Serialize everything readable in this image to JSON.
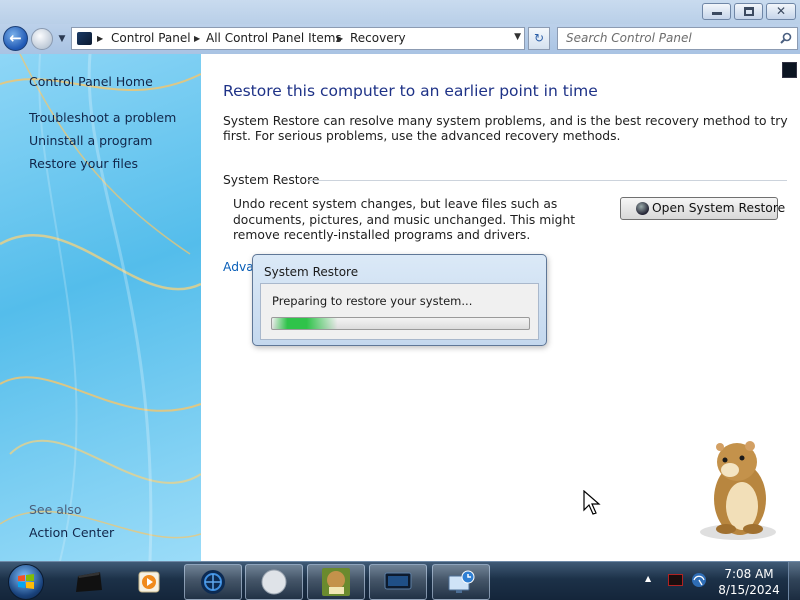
{
  "window": {
    "address_breadcrumbs": [
      "Control Panel",
      "All Control Panel Items",
      "Recovery"
    ],
    "search_placeholder": "Search Control Panel"
  },
  "sidebar": {
    "home": "Control Panel Home",
    "tasks": [
      "Troubleshoot a problem",
      "Uninstall a program",
      "Restore your files"
    ],
    "see_also_label": "See also",
    "see_also_links": [
      "Action Center"
    ]
  },
  "main": {
    "title": "Restore this computer to an earlier point in time",
    "intro": "System Restore can resolve many system problems, and is the best recovery method to try first. For serious problems, use the advanced recovery methods.",
    "section_title": "System Restore",
    "section_description": "Undo recent system changes, but leave files such as documents, pictures, and music unchanged. This might remove recently-installed programs and drivers.",
    "open_button": "Open System Restore",
    "advanced_link": "Adva"
  },
  "dialog": {
    "title": "System Restore",
    "message": "Preparing to restore your system...",
    "progress_fraction": 0.3
  },
  "taskbar": {
    "items": [
      "terminal-app-icon",
      "media-player-icon",
      "globe-app-icon",
      "blank-app-icon",
      "box-game-icon",
      "display-app-icon",
      "network-monitor-icon"
    ],
    "time": "7:08 AM",
    "date": "8/15/2024"
  },
  "colors": {
    "title_text": "#1e3287",
    "link": "#0a5fb8",
    "sidebar_top": "#8ed6f6",
    "sidebar_mid": "#54bdeb",
    "progress_green": "#2fc34a"
  }
}
